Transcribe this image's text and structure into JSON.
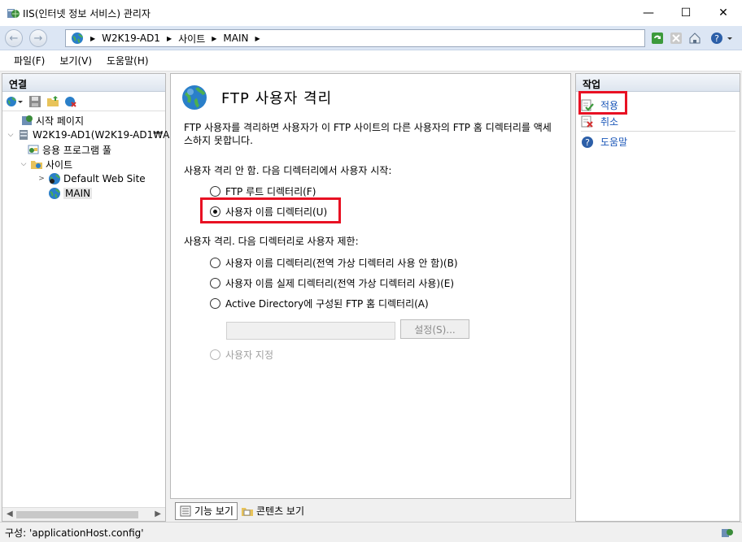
{
  "window": {
    "title": "IIS(인터넷 정보 서비스) 관리자",
    "minimize": "—",
    "maximize": "☐",
    "close": "✕"
  },
  "address": {
    "back": "←",
    "forward": "→",
    "segments": [
      "W2K19-AD1",
      "사이트",
      "MAIN"
    ],
    "separator": "▶"
  },
  "menu": [
    "파일(F)",
    "보기(V)",
    "도움말(H)"
  ],
  "connections": {
    "title": "연결",
    "tree": [
      {
        "label": "시작 페이지",
        "icon": "start-page-icon"
      },
      {
        "label": "W2K19-AD1(W2K19-AD1₩A",
        "icon": "server-icon"
      },
      {
        "label": "응용 프로그램 풀",
        "icon": "app-pool-icon"
      },
      {
        "label": "사이트",
        "icon": "sites-folder-icon"
      },
      {
        "label": "Default Web Site",
        "icon": "website-icon"
      },
      {
        "label": "MAIN",
        "icon": "globe-icon"
      }
    ]
  },
  "content": {
    "title": "FTP 사용자 격리",
    "description": "FTP 사용자를 격리하면 사용자가 이 FTP 사이트의 다른 사용자의 FTP 홈 디렉터리를 액세스하지 못합니다.",
    "group1_label": "사용자 격리 안 함. 다음 디렉터리에서 사용자 시작:",
    "group1_options": [
      "FTP 루트 디렉터리(F)",
      "사용자 이름 디렉터리(U)"
    ],
    "group2_label": "사용자 격리. 다음 디렉터리로 사용자 제한:",
    "group2_options": [
      "사용자 이름 디렉터리(전역 가상 디렉터리 사용 안 함)(B)",
      "사용자 이름 실제 디렉터리(전역 가상 디렉터리 사용)(E)",
      "Active Directory에 구성된 FTP 홈 디렉터리(A)"
    ],
    "settings_button": "설정(S)...",
    "custom_option": "사용자 지정",
    "selected_option": "사용자 이름 디렉터리(U)"
  },
  "view_tabs": [
    "기능 보기",
    "콘텐츠 보기"
  ],
  "actions": {
    "title": "작업",
    "items": [
      "적용",
      "취소",
      "도움말"
    ]
  },
  "status": {
    "text": "구성: 'applicationHost.config'"
  },
  "colors": {
    "highlight": "#e81123",
    "link": "#1a56b8",
    "pane_header": "#dde5ef"
  }
}
